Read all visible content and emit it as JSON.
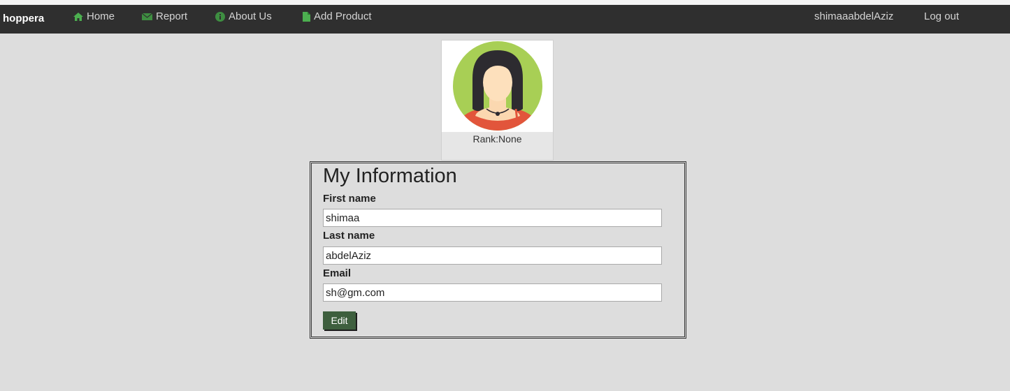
{
  "nav": {
    "brand": "hoppera",
    "links": [
      {
        "label": "Home",
        "icon": "home-icon"
      },
      {
        "label": "Report",
        "icon": "report-icon"
      },
      {
        "label": "About Us",
        "icon": "info-icon"
      },
      {
        "label": "Add Product",
        "icon": "document-icon"
      }
    ],
    "username": "shimaaabdelAziz",
    "logout": "Log out"
  },
  "profile": {
    "rank": "Rank:None"
  },
  "form": {
    "title": "My Information",
    "first_name_label": "First name",
    "first_name_value": "shimaa",
    "last_name_label": "Last name",
    "last_name_value": "abdelAziz",
    "email_label": "Email",
    "email_value": "sh@gm.com",
    "edit_label": "Edit"
  },
  "colors": {
    "navbar": "#2f2f2f",
    "background": "#dddddd",
    "icon_green": "#4caf50",
    "edit_button": "#3e5f3e"
  }
}
